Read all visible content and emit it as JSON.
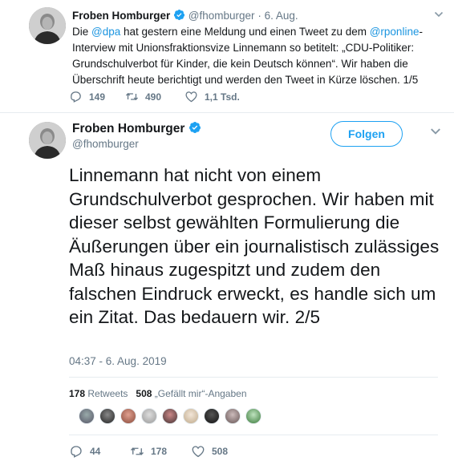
{
  "tweet1": {
    "name": "Froben Homburger",
    "handle": "@fhomburger",
    "separator": "·",
    "date": "6. Aug.",
    "text_pre": "Die ",
    "mention1": "@dpa",
    "text_mid": " hat gestern eine Meldung und einen Tweet zu dem ",
    "mention2": "@rponline",
    "text_post": "-Interview mit Unionsfraktionsvize Linnemann so betitelt: „CDU-Politiker: Grundschulverbot für Kinder, die kein Deutsch können“. Wir haben die Überschrift heute berichtigt und werden den Tweet in Kürze löschen. 1/5",
    "replies": "149",
    "retweets": "490",
    "likes": "1,1 Tsd."
  },
  "tweet2": {
    "name": "Froben Homburger",
    "handle": "@fhomburger",
    "follow_label": "Folgen",
    "text": "Linnemann hat nicht von einem Grundschulverbot gesprochen. Wir haben mit dieser selbst gewählten Formulierung die Äußerungen über ein journalistisch zulässiges Maß hinaus zugespitzt und zudem den falschen Eindruck erweckt, es handle sich um ein Zitat. Das bedauern wir. 2/5",
    "timestamp": "04:37 - 6. Aug. 2019",
    "retweet_count": "178",
    "retweet_label": "Retweets",
    "like_count": "508",
    "like_label": "„Gefällt mir“-Angaben",
    "replies": "44",
    "retweets": "178",
    "likes": "508"
  },
  "colors": {
    "accent": "#1da1f2",
    "link": "#1b95e0",
    "muted": "#657786",
    "text": "#14171a"
  },
  "icons": [
    "verified-badge-icon",
    "chevron-down-icon",
    "reply-icon",
    "retweet-icon",
    "heart-icon"
  ]
}
